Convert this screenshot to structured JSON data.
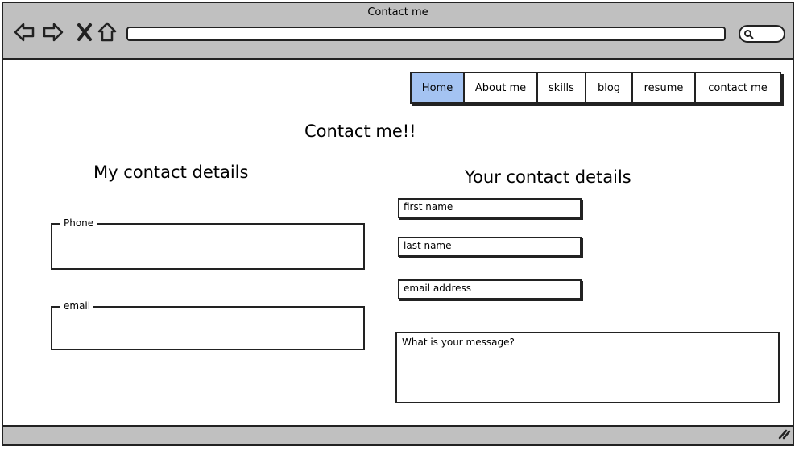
{
  "window": {
    "title": "Contact me"
  },
  "toolbar": {
    "back_icon": "back-arrow-icon",
    "forward_icon": "forward-arrow-icon",
    "stop_icon": "close-icon",
    "home_icon": "home-icon",
    "search_icon": "search-icon",
    "url": ""
  },
  "nav": {
    "tabs": [
      {
        "label": "Home",
        "active": true
      },
      {
        "label": "About me",
        "active": false
      },
      {
        "label": "skills",
        "active": false
      },
      {
        "label": "blog",
        "active": false
      },
      {
        "label": "resume",
        "active": false
      },
      {
        "label": "contact me",
        "active": false
      }
    ]
  },
  "page": {
    "title": "Contact me!!",
    "my_details": {
      "heading": "My contact details",
      "phone_label": "Phone",
      "phone_value": "",
      "email_label": "email",
      "email_value": ""
    },
    "your_details": {
      "heading": "Your contact details",
      "first_name": "first name",
      "last_name": "last name",
      "email": "email address",
      "message": "What is your message?"
    }
  },
  "colors": {
    "active_tab": "#a4c3f2",
    "chrome": "#c0c0c0"
  }
}
